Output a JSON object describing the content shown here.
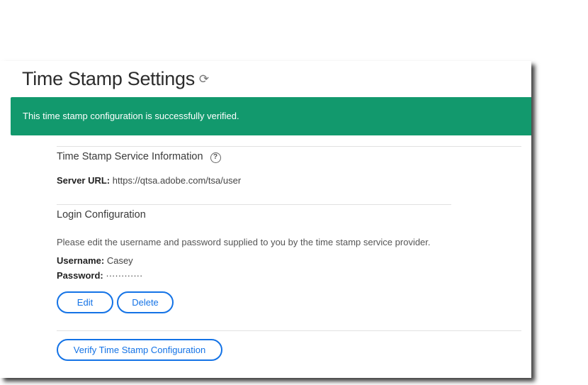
{
  "title": "Time Stamp Settings",
  "banner": "This time stamp configuration is successfully verified.",
  "service": {
    "heading": "Time Stamp Service Information",
    "server_label": "Server URL:",
    "server_url": "https://qtsa.adobe.com/tsa/user"
  },
  "login": {
    "heading": "Login Configuration",
    "description": "Please edit the username and password supplied to you by the time stamp service provider.",
    "username_label": "Username:",
    "username": "Casey",
    "password_label": "Password:",
    "password": "············"
  },
  "buttons": {
    "edit": "Edit",
    "delete": "Delete",
    "verify": "Verify Time Stamp Configuration"
  },
  "colors": {
    "banner": "#12996d",
    "accent": "#1473e6"
  }
}
